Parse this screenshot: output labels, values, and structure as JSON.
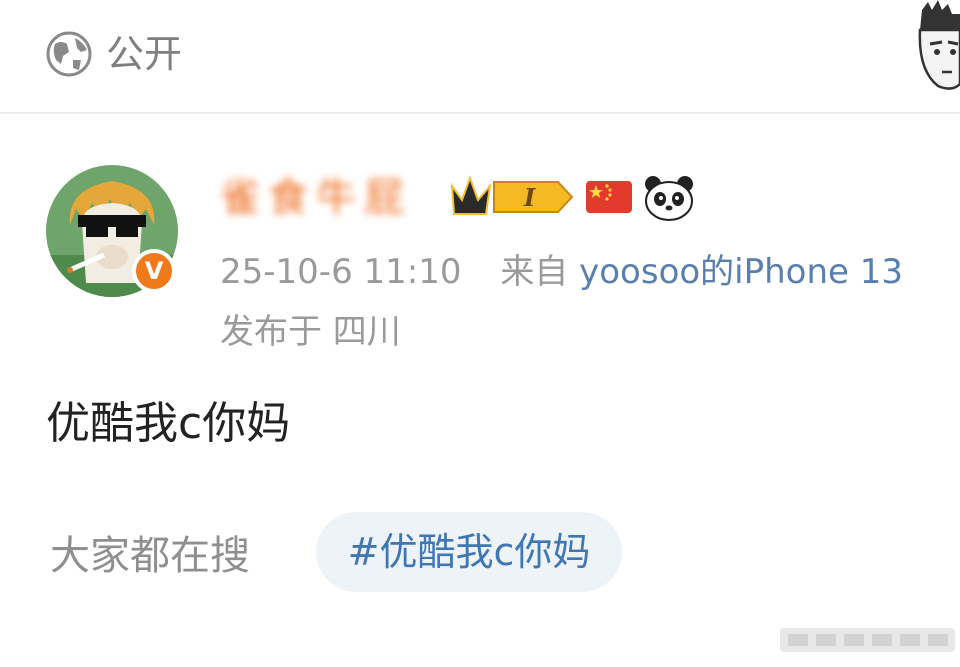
{
  "header": {
    "visibility_icon": "globe-icon",
    "visibility_label": "公开",
    "sticker": "cartoon-face-sticker"
  },
  "post": {
    "author": {
      "name": "雀食牛屁",
      "avatar": "alpaca-sunglasses-avatar",
      "verified_badge": "V",
      "badges": [
        "crown-badge",
        "level-badge",
        "china-flag-icon",
        "panda-icon"
      ],
      "level_label": "I"
    },
    "timestamp": "25-10-6 11:10",
    "source_prefix": "来自",
    "source": "yoosoo的iPhone 13",
    "location": "发布于 四川",
    "text": "优酷我c你妈"
  },
  "trending": {
    "label": "大家都在搜",
    "tag": "#优酷我c你妈"
  },
  "colors": {
    "accent_orange": "#f07a1a",
    "link_blue": "#5a7fae",
    "tag_bg": "#eef3f8"
  }
}
